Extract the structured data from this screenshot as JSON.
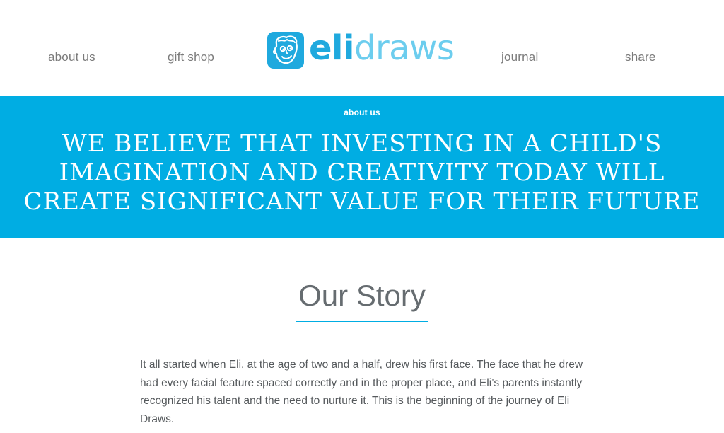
{
  "nav": {
    "about_label": "about us",
    "gift_label": "gift shop",
    "journal_label": "journal",
    "share_label": "share"
  },
  "logo": {
    "part1": "eli",
    "part2": "draws",
    "icon": "boy-face-logo-icon"
  },
  "banner": {
    "label": "about us",
    "headline": "We believe that investing in a child's imagination and creativity today will create significant value for their future"
  },
  "story": {
    "title": "Our Story",
    "body": "It all started when Eli, at the age of two and a half, drew his first face. The face that he drew had every facial feature spaced correctly and in the proper place, and Eli’s parents instantly recognized his talent and the need to nurture it. This is the beginning of the journey of Eli Draws."
  },
  "colors": {
    "accent": "#00ade3",
    "logo_dark": "#1fa9de",
    "logo_light": "#6ccdee",
    "nav_text": "#7b7b7b",
    "body_text": "#55595c"
  }
}
